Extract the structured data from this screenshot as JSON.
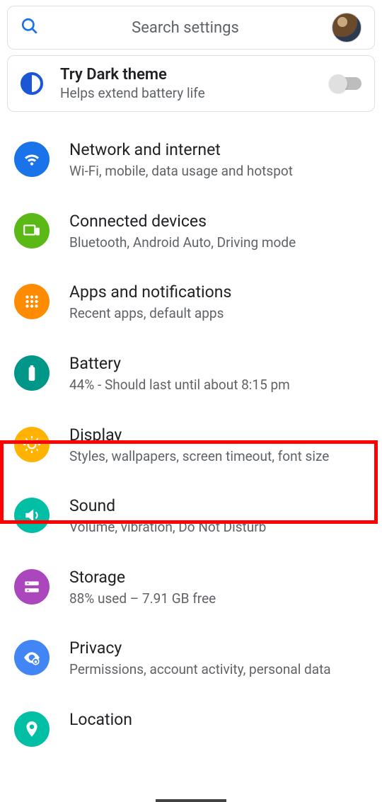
{
  "search": {
    "placeholder": "Search settings"
  },
  "promo": {
    "title": "Try Dark theme",
    "subtitle": "Helps extend battery life"
  },
  "items": [
    {
      "title": "Network and internet",
      "subtitle": "Wi-Fi, mobile, data usage and hotspot"
    },
    {
      "title": "Connected devices",
      "subtitle": "Bluetooth, Android Auto, Driving mode"
    },
    {
      "title": "Apps and notifications",
      "subtitle": "Recent apps, default apps"
    },
    {
      "title": "Battery",
      "subtitle": "44% - Should last until about 8:15 pm"
    },
    {
      "title": "Display",
      "subtitle": "Styles, wallpapers, screen timeout, font size"
    },
    {
      "title": "Sound",
      "subtitle": "Volume, vibration, Do Not Disturb"
    },
    {
      "title": "Storage",
      "subtitle": "88% used – 7.91 GB free"
    },
    {
      "title": "Privacy",
      "subtitle": "Permissions, account activity, personal data"
    },
    {
      "title": "Location",
      "subtitle": ""
    }
  ]
}
